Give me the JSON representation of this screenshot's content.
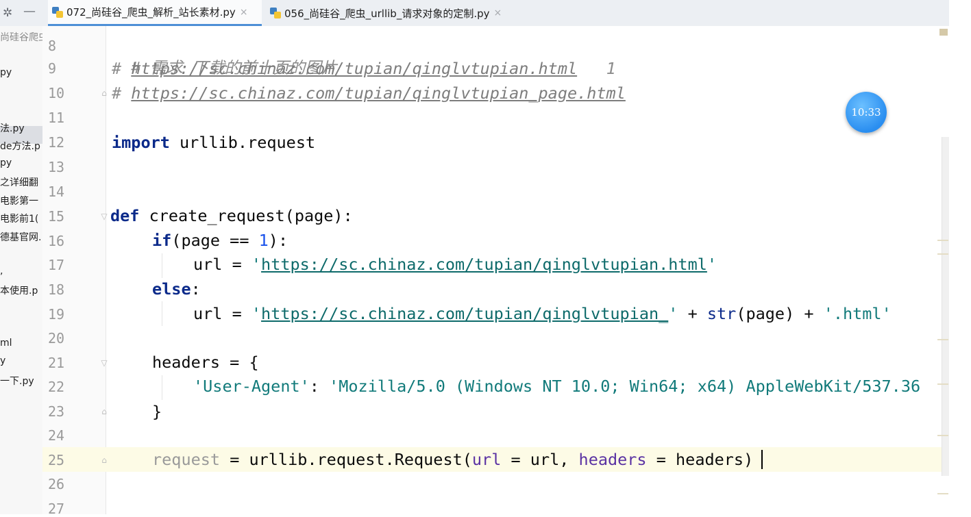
{
  "tabs": [
    {
      "label": "072_尚硅谷_爬虫_解析_站长素材.py",
      "active": true
    },
    {
      "label": "056_尚硅谷_爬虫_urllib_请求对象的定制.py",
      "active": false
    }
  ],
  "tab_close_glyph": "×",
  "sidebar": {
    "items": [
      "尚硅谷爬虫",
      "py",
      "法.py",
      "de方法.p",
      "py",
      "之详细翻",
      "电影第一",
      "电影前1(",
      "德基官网.",
      ",",
      "本使用.p",
      "ml",
      "y",
      "一下.py"
    ]
  },
  "line_numbers": [
    "8",
    "9",
    "10",
    "11",
    "12",
    "13",
    "14",
    "15",
    "16",
    "17",
    "18",
    "19",
    "20",
    "21",
    "22",
    "23",
    "24",
    "25",
    "26",
    "27"
  ],
  "code": {
    "l8": "# 需求 下载的前十页的图片",
    "l9_prefix": "# ",
    "l9_url": "https://sc.chinaz.com/tupian/qinglvtupian.html",
    "l9_suffix": "   1",
    "l10_prefix": "# ",
    "l10_url": "https://sc.chinaz.com/tupian/qinglvtupian_page.html",
    "l12_kw": "import",
    "l12_rest": " urllib.request",
    "l15_kw": "def",
    "l15_rest": " create_request(page):",
    "l16_kw": "if",
    "l16_a": "(page == ",
    "l16_num": "1",
    "l16_b": "):",
    "l17_a": "url = ",
    "l17_q1": "'",
    "l17_url": "https://sc.chinaz.com/tupian/qinglvtupian.html",
    "l17_q2": "'",
    "l18_kw": "else",
    "l18_b": ":",
    "l19_a": "url = ",
    "l19_q1": "'",
    "l19_url": "https://sc.chinaz.com/tupian/qinglvtupian_",
    "l19_q2": "'",
    "l19_b": " + ",
    "l19_fn": "str",
    "l19_c": "(page) + ",
    "l19_str": "'.html'",
    "l21": "headers = {",
    "l22_key": "'User-Agent'",
    "l22_colon": ": ",
    "l22_val": "'Mozilla/5.0 (Windows NT 10.0; Win64; x64) AppleWebKit/537.36",
    "l23": "}",
    "l25_var": "request",
    "l25_a": " = urllib.request.Request(",
    "l25_k1": "url",
    "l25_b": " = url, ",
    "l25_k2": "headers",
    "l25_c": " = headers)"
  },
  "clock_time": "10:33",
  "colors": {
    "keyword": "#0b2a8a",
    "string": "#117a7a",
    "comment": "#8c8c8c",
    "number": "#1750eb",
    "tab_accent": "#4d8fd6",
    "current_line": "#fdfbe6"
  },
  "icons": [
    "gear-icon",
    "minimize-icon",
    "python-file-icon",
    "close-icon",
    "fold-icon"
  ]
}
